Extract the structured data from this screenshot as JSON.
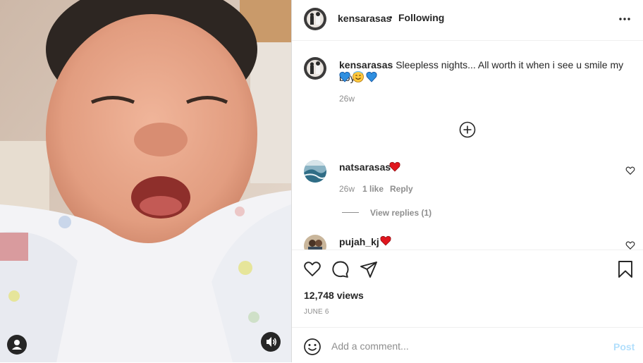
{
  "post": {
    "username": "kensarasas",
    "follow_separator": "•",
    "follow_status": "Following",
    "caption": "Sleepless nights... All worth it when i see u smile my boy",
    "caption_emojis": [
      "blue-heart",
      "smiling-face",
      "blue-heart"
    ],
    "caption_time": "26w",
    "views": "12,748 views",
    "date": "JUNE 6"
  },
  "comments": [
    {
      "username": "natsarasas",
      "emoji": "red-heart",
      "time": "26w",
      "likes": "1 like",
      "reply": "Reply",
      "view_replies": "View replies (1)"
    },
    {
      "username": "pujah_kj",
      "emoji": "red-heart"
    }
  ],
  "composer": {
    "placeholder": "Add a comment...",
    "post_label": "Post"
  },
  "colors": {
    "accent_blue": "#0095f6",
    "post_disabled": "#b2dffc",
    "heart_red": "#ed4956",
    "border": "#dbdbdb",
    "muted": "#8e8e8e"
  }
}
